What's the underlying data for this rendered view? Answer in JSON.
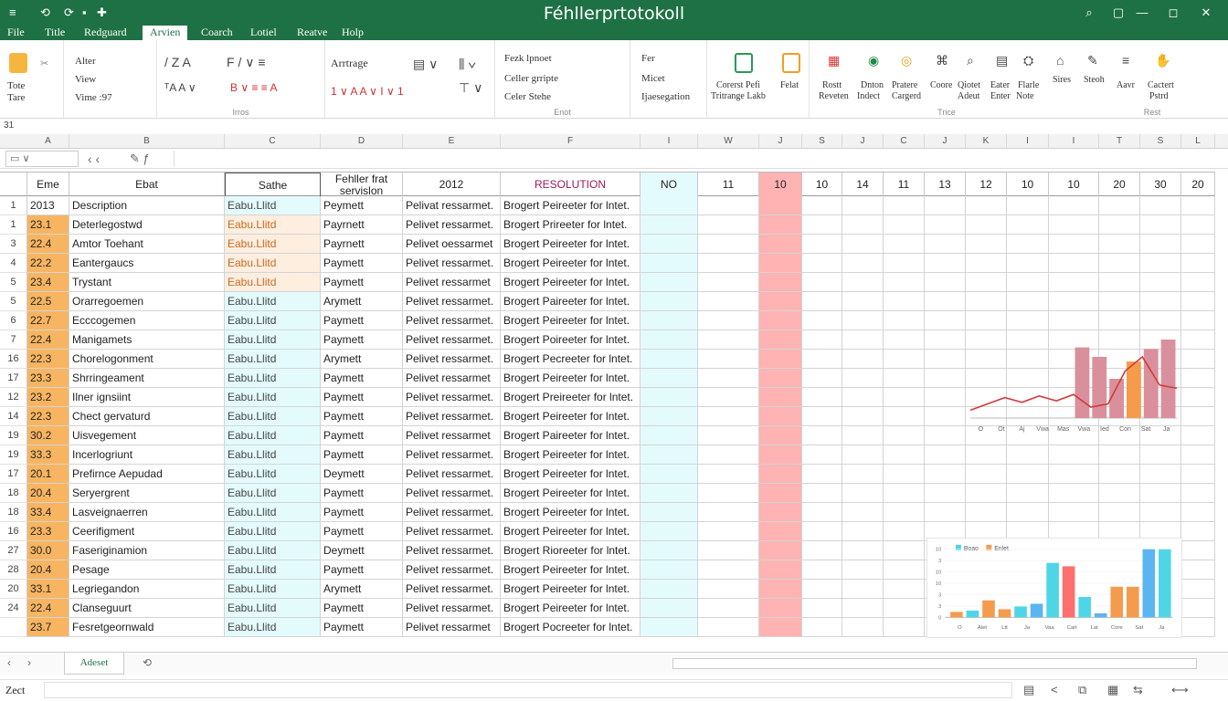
{
  "window": {
    "title": "Féhllerprtotokoll",
    "quick_access": [
      "≡",
      "⟲",
      "⟳",
      "▪",
      "✚"
    ],
    "controls": [
      "⌕",
      "▢",
      "—",
      "◻",
      "✕"
    ]
  },
  "menu_tabs": [
    "File",
    "Title",
    "Redguard",
    "Arvien",
    "Coarch",
    "Lotiel",
    "Reatve",
    "Holp"
  ],
  "active_tab_index": 3,
  "ribbon": {
    "paste_label_1": "Tote",
    "paste_label_2": "Tare",
    "clip_items": [
      "Alter",
      "View",
      "Vime :97"
    ],
    "font_name": "Arrtrage",
    "group_labels": [
      "Irros",
      "Enot",
      "Trice",
      "Rest"
    ],
    "edit_items": [
      "Fezk lpnoet",
      "Celler grripte",
      "Celer Stehe"
    ],
    "mid_items": [
      "Fer",
      "Micet",
      "Ijaesegation"
    ],
    "cond_labels": [
      "Corerst Pefi",
      "Tritrange Lakb",
      "Felat"
    ],
    "right_labels_top": [
      "Rostt",
      "Dnton",
      "Pratere",
      "Coore",
      "Qiotet",
      "Eater",
      "Flarle",
      "Sires",
      "Steoh",
      "Aavr",
      "Cactert"
    ],
    "right_labels_bottom": [
      "Reveten",
      "Indect",
      "Cargerd",
      "Adeut",
      "Enter",
      "Note",
      "Pstrd"
    ]
  },
  "name_box": "31",
  "columns": [
    "A",
    "B",
    "C",
    "D",
    "E",
    "F",
    "I",
    "W",
    "J",
    "S",
    "J",
    "C",
    "J",
    "K",
    "I",
    "I",
    "T",
    "S",
    "L"
  ],
  "header_row": [
    "Eme",
    "Ebat",
    "Sathe",
    "Fehller frat servislon",
    "2012",
    "RESOLUTION",
    "NO",
    "11",
    "10",
    "10",
    "14",
    "11",
    "13",
    "12",
    "10",
    "10",
    "20",
    "30",
    "20"
  ],
  "row_numbers": [
    "1",
    "1",
    "3",
    "4",
    "5",
    "5",
    "6",
    "7",
    "16",
    "17",
    "12",
    "14",
    "19",
    "19",
    "17",
    "18",
    "18",
    "16",
    "27",
    "28",
    "20",
    "24"
  ],
  "rows": [
    [
      "2013",
      "Description",
      "Eabu.Llitd",
      "Peymett",
      "Pelivat ressarmet.",
      "Brogert Peireeter for lntet."
    ],
    [
      "23.1",
      "Deterlegostwd",
      "Eabu.Llitd",
      "Payrnett",
      "Pelivet ressarmet.",
      "Brogert Prireeter for lntet."
    ],
    [
      "22.4",
      "Amtor Toehant",
      "Eabu.Llitd",
      "Payrnett",
      "Pelivet oessarmet",
      "Brogert Peireeter for lntet."
    ],
    [
      "22.2",
      "Eantergaucs",
      "Eabu.Llitd",
      "Paymett",
      "Pelivet ressarmet.",
      "Brogert Peireeter for lntet."
    ],
    [
      "23.4",
      "Trystant",
      "Eabu.Llitd",
      "Paymett",
      "Pelivet ressarmet",
      "Brogert Peireeter for lntet."
    ],
    [
      "22.5",
      "Orarregoemen",
      "Eabu.Llitd",
      "Arymett",
      "Pelivet ressarmet.",
      "Brogert Paireeter for lntet."
    ],
    [
      "22.7",
      "Ecccogemen",
      "Eabu.Llitd",
      "Paymett",
      "Pelivet ressarmet.",
      "Brogert Peireeter for lntet."
    ],
    [
      "22.4",
      "Manigamets",
      "Eabu.Llitd",
      "Paymett",
      "Pelivet ressarmet.",
      "Brogert Poireeter for lntet."
    ],
    [
      "22.3",
      "Chorelogonment",
      "Eabu.Llitd",
      "Arymett",
      "Pelivet ressarmet.",
      "Brogert Pecreeter for lntet."
    ],
    [
      "23.3",
      "Shrringeament",
      "Eabu.Llitd",
      "Paymett",
      "Pelivet ressarmet",
      "Brogert Peireeter for lntet."
    ],
    [
      "23.2",
      "Ilner ignsiint",
      "Eabu.Llitd",
      "Paymett",
      "Pelivet ressarmet.",
      "Brogert Preireeter for lntet."
    ],
    [
      "22.3",
      "Chect gervaturd",
      "Eabu.Llitd",
      "Paymett",
      "Pelivet ressarmet.",
      "Brogert Peireeter for lntet."
    ],
    [
      "30.2",
      "Uisvegement",
      "Eabu.Llitd",
      "Paymett",
      "Pelivet ressarmet",
      "Brogert Paireeter for lntet."
    ],
    [
      "33.3",
      "Incerlogriunt",
      "Eabu.Llitd",
      "Paymett",
      "Pelivet ressarmet.",
      "Brogert Peireeter for lntet."
    ],
    [
      "20.1",
      "Prefirnce Aepudad",
      "Eabu.Llitd",
      "Deymett",
      "Pelivet ressarmet.",
      "Brogert Peireeter for lntet."
    ],
    [
      "20.4",
      "Seryergrent",
      "Eabu.Llitd",
      "Paymett",
      "Pelivet ressarmet.",
      "Brogert Peireeter for lntet."
    ],
    [
      "33.4",
      "Lasveignaerren",
      "Eabu.Llitd",
      "Paymett",
      "Pelivet ressarmet.",
      "Brogert Peireeter for lntet."
    ],
    [
      "23.3",
      "Ceerifigment",
      "Eabu.Llitd",
      "Paymett",
      "Pelivet ressarmet.",
      "Brogert Peireeter for lntet."
    ],
    [
      "30.0",
      "Faseriginamion",
      "Eabu.Llitd",
      "Deymett",
      "Pelivet ressarmet.",
      "Brogert Rioreeter for lntet."
    ],
    [
      "20.4",
      "Pesage",
      "Eabu.Llitd",
      "Paymett",
      "Pelivet ressarmet.",
      "Brogert Peireeter for lntet."
    ],
    [
      "33.1",
      "Legriegandon",
      "Eabu.Llitd",
      "Arymett",
      "Pelivet ressarmet.",
      "Brogert Peireeter for lntet."
    ],
    [
      "22.4",
      "Clanseguurt",
      "Eabu.Llitd",
      "Paymett",
      "Pelivet ressarmet.",
      "Brogert Peireeter for lntet."
    ],
    [
      "23.7",
      "Fesretgeornwald",
      "Eabu.Llitd",
      "Paymett",
      "Pelivet ressarmet",
      "Brogert Pocreeter for lntet."
    ]
  ],
  "colors": {
    "brand": "#1e7145",
    "orange_cell": "#f7b562",
    "peach_cell": "#fdeee0",
    "cyan_cell": "#e4fbfd",
    "red_column": "#ffb3b3",
    "resolution_text": "#9a1a5a",
    "bar_pink": "#d9909c",
    "bar_orange": "#f59b4d",
    "bar_cyan": "#4fd6e6",
    "bar_red": "#ff6f6f",
    "bar_blue": "#5ab5f0",
    "line_red": "#d33a3a"
  },
  "chart1": {
    "type": "bar",
    "x_labels": [
      "O",
      "Ot",
      "Aj",
      "Vwa",
      "Mas",
      "Vwa",
      "Ied",
      "Con",
      "Sat",
      "Ja"
    ],
    "bar_values": [
      0,
      0,
      0,
      0,
      0,
      0,
      90,
      78,
      50,
      72,
      88,
      100
    ],
    "bar_colors": [
      "pink",
      "pink",
      "pink",
      "pink",
      "pink",
      "pink",
      "pink",
      "pink",
      "pink",
      "orange",
      "pink",
      "pink"
    ],
    "line_values": [
      10,
      18,
      26,
      20,
      28,
      22,
      30,
      14,
      18,
      60,
      78,
      42,
      38
    ],
    "ylim": [
      0,
      100
    ]
  },
  "chart2": {
    "type": "bar",
    "legend": [
      "Boao",
      "Enlet"
    ],
    "y_ticks": [
      "10",
      "3",
      "10",
      "10",
      "3",
      "3",
      "0"
    ],
    "x_labels": [
      "O",
      "Alet",
      "Ltt",
      "Ja",
      "Vaa",
      "Cart",
      "Lat",
      "Core",
      "Sat",
      "Ja"
    ],
    "values": [
      8,
      10,
      25,
      12,
      16,
      20,
      80,
      75,
      30,
      6,
      45,
      45,
      100,
      100
    ],
    "colors": [
      "orange",
      "cyan",
      "orange",
      "orange",
      "cyan",
      "blue",
      "cyan",
      "red",
      "cyan",
      "blue",
      "orange",
      "orange",
      "blue",
      "cyan"
    ],
    "ylim": [
      0,
      100
    ]
  },
  "sheet_tabs": [
    "Adeset",
    "⟲"
  ],
  "status": {
    "text": "Zect",
    "icons": [
      "▤",
      "<",
      "⧉",
      "▦",
      "⇆",
      "⟷"
    ]
  }
}
